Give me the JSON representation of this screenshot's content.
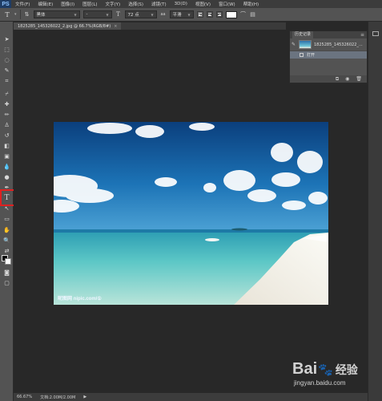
{
  "app": {
    "logo": "PS"
  },
  "menu": [
    "文件(F)",
    "编辑(E)",
    "图像(I)",
    "图层(L)",
    "文字(Y)",
    "选择(S)",
    "滤镜(T)",
    "3D(D)",
    "视图(V)",
    "窗口(W)",
    "帮助(H)"
  ],
  "options": {
    "tool_glyph": "T",
    "font_family": "黑体",
    "font_style": "-",
    "size_glyph": "T",
    "font_size": "72 点",
    "aa_label": "aa",
    "antialias": "平滑",
    "text_color": "#ffffff"
  },
  "document": {
    "tab_title": "1825285_145326022_2.jpg @ 66.7%(RGB/8#)",
    "close": "×"
  },
  "history": {
    "tab_label": "历史记录",
    "menu_glyph": "≡",
    "snapshot_name": "1825285_145326022_...",
    "state_name": "打开"
  },
  "photo": {
    "watermark": "昵图网 nipic.com/①"
  },
  "status": {
    "zoom": "66.67%",
    "doc_info": "文档:2.00M/2.00M",
    "arrow": "▶"
  },
  "baidu": {
    "brand_left": "Bai",
    "brand_right": "经验",
    "url": "jingyan.baidu.com"
  },
  "colors": {
    "highlight": "#e02020",
    "foreground": "#000000",
    "background": "#ffffff"
  }
}
